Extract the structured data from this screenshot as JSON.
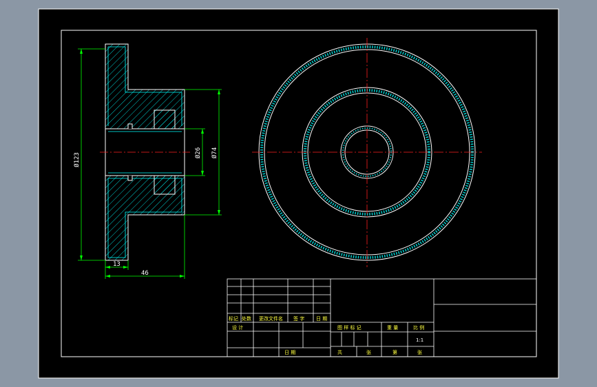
{
  "drawing": {
    "dimensions": {
      "outer_diameter": "Ø123",
      "hub_diameter": "Ø74",
      "bore_diameter": "Ø26",
      "flange_thickness": "13",
      "overall_length": "46"
    },
    "title_block": {
      "change_labels": [
        "标记",
        "处数",
        "更改文件名",
        "签 字",
        "日 期"
      ],
      "design_label": "设 计",
      "date_label": "日 期",
      "stage_label": "图 样 标 记",
      "weight_label": "重 量",
      "scale_label": "比 例",
      "scale_value": "1:1",
      "sheets_total_label": "共",
      "sheets_unit_label": "张",
      "sheet_no_label": "第",
      "sheet_no_unit_label": "张"
    },
    "colors": {
      "background": "#8b97a5",
      "paper": "#000000",
      "outline": "#ffffff",
      "section": "#00ffff",
      "dimension": "#00ff00",
      "centerline": "#ff2020",
      "title_text": "#ffff40"
    }
  }
}
